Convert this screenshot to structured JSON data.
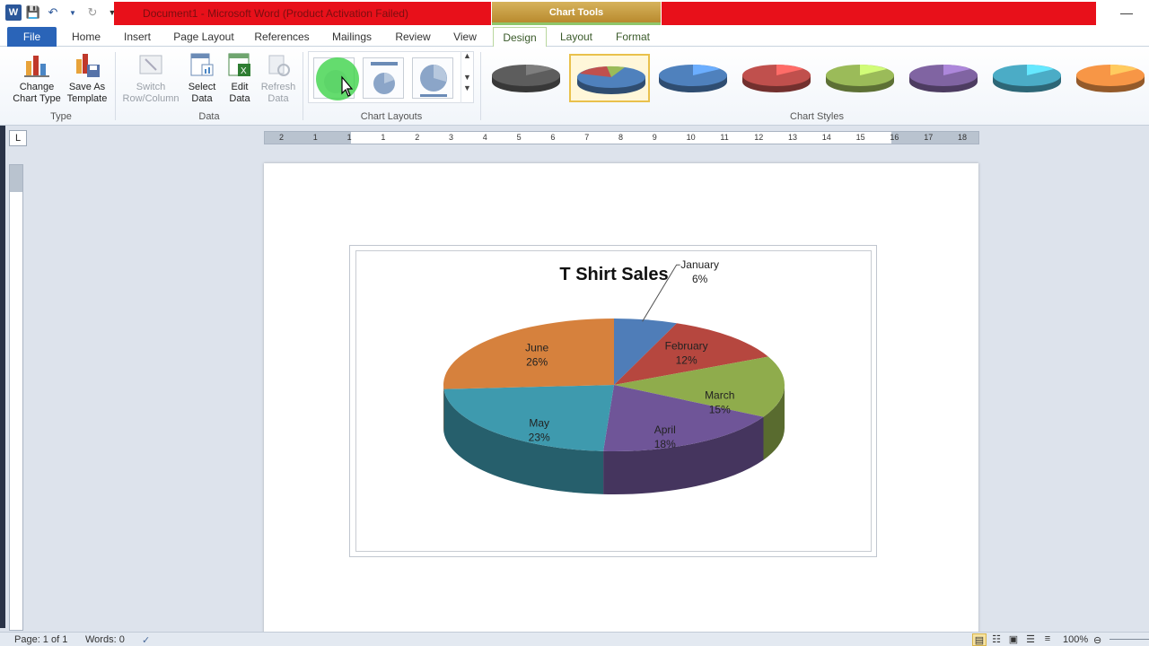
{
  "title_bar": {
    "document_title": "Document1  -  Microsoft Word (Product Activation Failed)",
    "context_tab": "Chart Tools"
  },
  "tabs": [
    "File",
    "Home",
    "Insert",
    "Page Layout",
    "References",
    "Mailings",
    "Review",
    "View",
    "Design",
    "Layout",
    "Format"
  ],
  "ribbon": {
    "type_group": {
      "label": "Type",
      "change_chart_type": [
        "Change",
        "Chart Type"
      ],
      "save_as_template": [
        "Save As",
        "Template"
      ]
    },
    "data_group": {
      "label": "Data",
      "switch": [
        "Switch",
        "Row/Column"
      ],
      "select_data": [
        "Select",
        "Data"
      ],
      "edit_data": [
        "Edit",
        "Data"
      ],
      "refresh_data": [
        "Refresh",
        "Data"
      ]
    },
    "layouts_label": "Chart Layouts",
    "styles_label": "Chart Styles",
    "style_colors": [
      "#5d5d5d",
      "#4f81bd",
      "#4f81bd",
      "#c0504d",
      "#9bbb59",
      "#8064a2",
      "#4bacc6",
      "#f79646"
    ]
  },
  "ruler": {
    "numbers": [
      "2",
      "1",
      "1",
      "1",
      "2",
      "3",
      "4",
      "5",
      "6",
      "7",
      "8",
      "9",
      "10",
      "11",
      "12",
      "13",
      "14",
      "15",
      "16",
      "17",
      "18"
    ]
  },
  "chart_data": {
    "type": "pie",
    "title": "T Shirt Sales",
    "categories": [
      "January",
      "February",
      "March",
      "April",
      "May",
      "June"
    ],
    "values": [
      6,
      12,
      15,
      18,
      23,
      26
    ],
    "labels": [
      "6%",
      "12%",
      "15%",
      "18%",
      "23%",
      "26%"
    ],
    "colors": [
      "#4f7db8",
      "#b6473f",
      "#8fac4c",
      "#6f5598",
      "#3e9aae",
      "#d6813d"
    ],
    "legend": "none",
    "style": "3d"
  },
  "status": {
    "page": "Page: 1 of 1",
    "words": "Words: 0",
    "zoom": "100%"
  }
}
